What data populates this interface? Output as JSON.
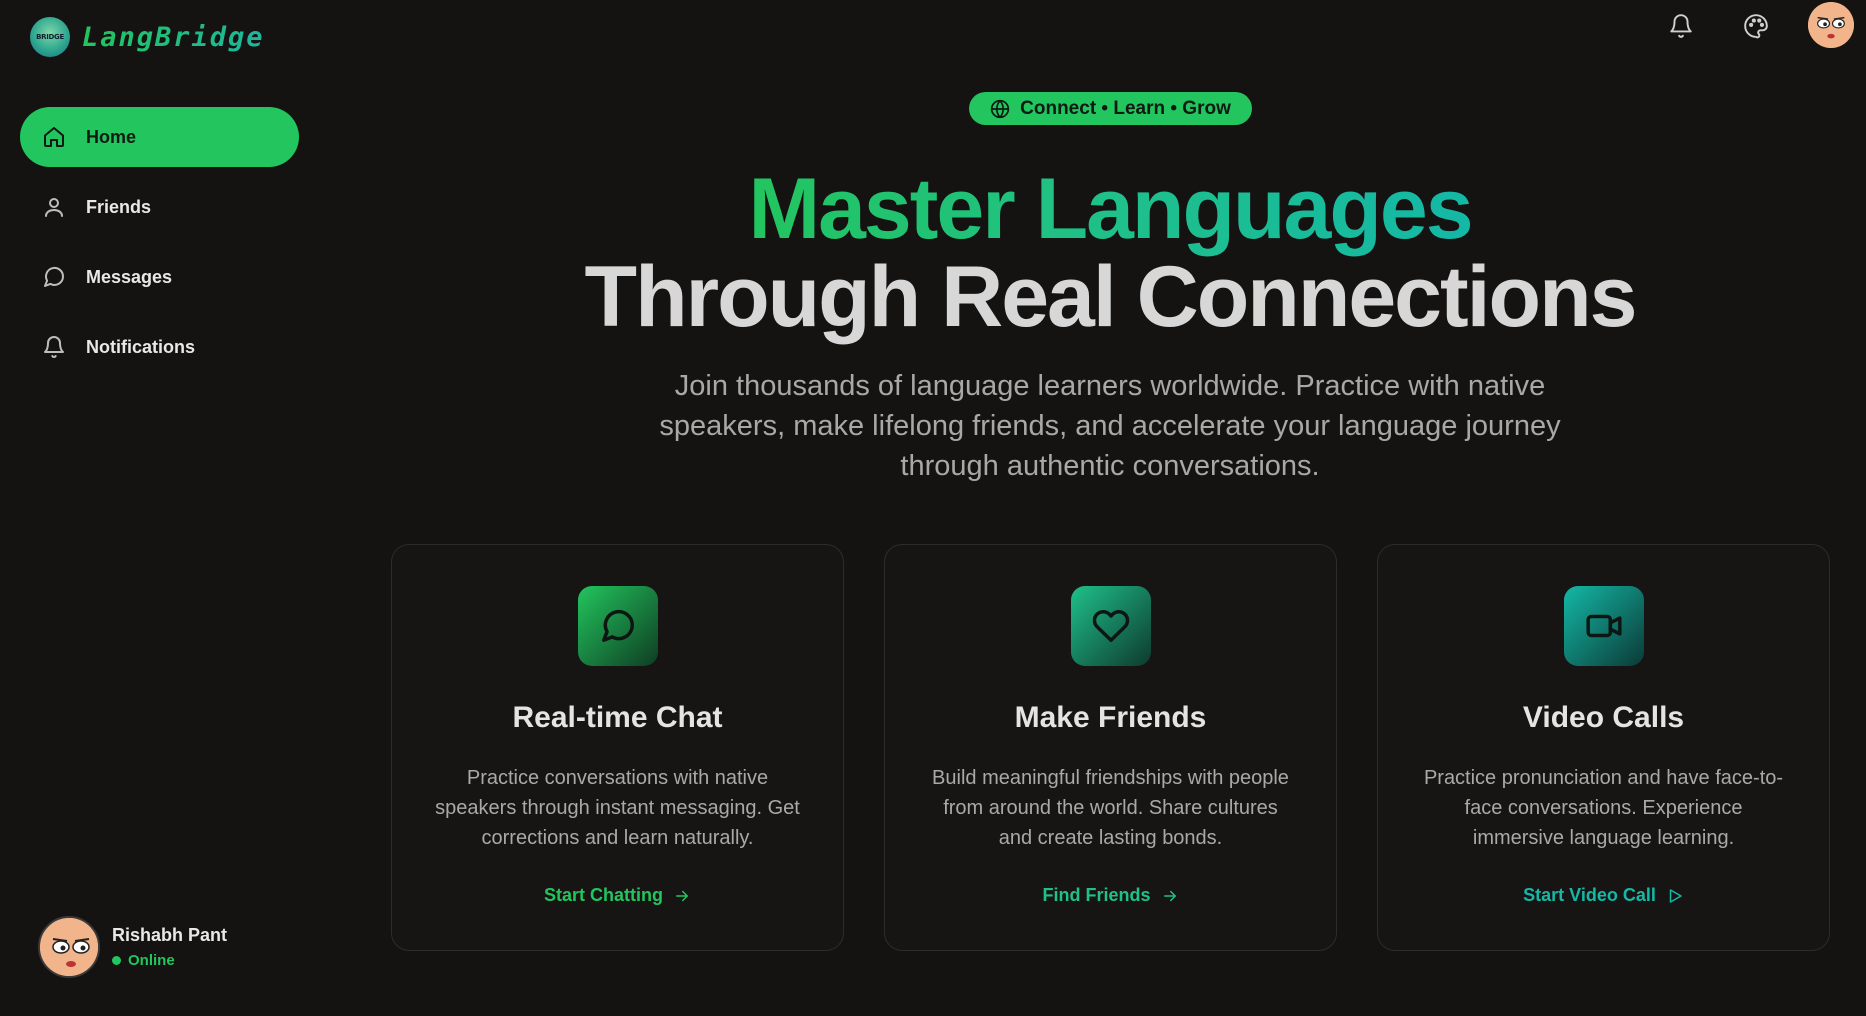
{
  "brand": {
    "name": "LangBridge",
    "logo_text": "BRIDGE"
  },
  "sidebar": {
    "items": [
      {
        "label": "Home",
        "icon": "home-icon",
        "active": true
      },
      {
        "label": "Friends",
        "icon": "user-icon",
        "active": false
      },
      {
        "label": "Messages",
        "icon": "message-circle-icon",
        "active": false
      },
      {
        "label": "Notifications",
        "icon": "bell-icon",
        "active": false
      }
    ]
  },
  "user": {
    "name": "Rishabh Pant",
    "status": "Online"
  },
  "header": {
    "icons": [
      "bell-icon",
      "palette-icon",
      "avatar"
    ]
  },
  "hero": {
    "badge": "Connect • Learn • Grow",
    "title_line1": "Master Languages",
    "title_line2": "Through Real Connections",
    "subtitle": "Join thousands of language learners worldwide. Practice with native speakers, make lifelong friends, and accelerate your language journey through authentic conversations."
  },
  "cards": [
    {
      "title": "Real-time Chat",
      "description": "Practice conversations with native speakers through instant messaging. Get corrections and learn naturally.",
      "link": "Start Chatting",
      "icon": "message-circle-icon",
      "color": "#22c55e"
    },
    {
      "title": "Make Friends",
      "description": "Build meaningful friendships with people from around the world. Share cultures and create lasting bonds.",
      "link": "Find Friends",
      "icon": "heart-icon",
      "color": "#1fc08a"
    },
    {
      "title": "Video Calls",
      "description": "Practice pronunciation and have face-to-face conversations. Experience immersive language learning.",
      "link": "Start Video Call",
      "icon": "video-icon",
      "color": "#14b8a6"
    }
  ],
  "colors": {
    "accent": "#22c55e",
    "teal": "#14b8a6",
    "background": "#151212"
  }
}
